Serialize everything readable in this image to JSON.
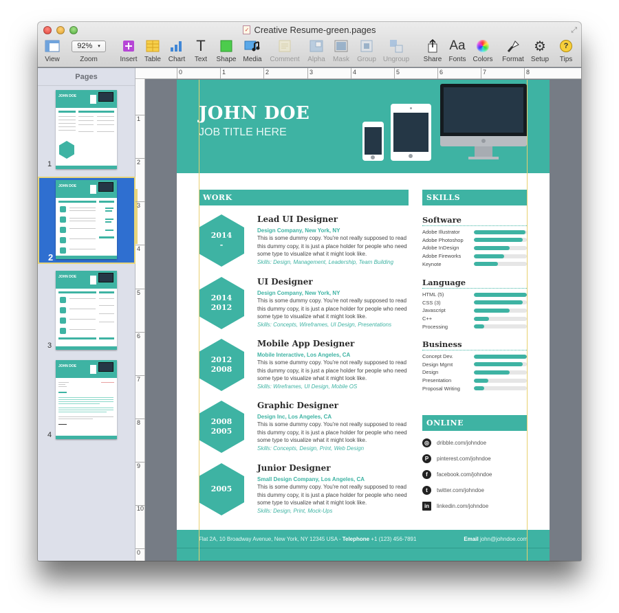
{
  "window": {
    "title": "Creative Resume-green.pages",
    "doc_icon": "pages-doc-icon"
  },
  "toolbar": {
    "zoom_value": "92%",
    "items": [
      {
        "label": "View",
        "icon": "view-icon",
        "enabled": true
      },
      {
        "label": "Zoom",
        "icon": "zoom-dropdown",
        "enabled": true
      },
      {
        "label": "Insert",
        "icon": "insert-icon",
        "enabled": true
      },
      {
        "label": "Table",
        "icon": "table-icon",
        "enabled": true
      },
      {
        "label": "Chart",
        "icon": "chart-icon",
        "enabled": true
      },
      {
        "label": "Text",
        "icon": "text-icon",
        "enabled": true
      },
      {
        "label": "Shape",
        "icon": "shape-icon",
        "enabled": true
      },
      {
        "label": "Media",
        "icon": "media-icon",
        "enabled": true
      },
      {
        "label": "Comment",
        "icon": "comment-icon",
        "enabled": false
      },
      {
        "label": "Alpha",
        "icon": "alpha-icon",
        "enabled": false
      },
      {
        "label": "Mask",
        "icon": "mask-icon",
        "enabled": false
      },
      {
        "label": "Group",
        "icon": "group-icon",
        "enabled": false
      },
      {
        "label": "Ungroup",
        "icon": "ungroup-icon",
        "enabled": false
      },
      {
        "label": "Share",
        "icon": "share-icon",
        "enabled": true
      },
      {
        "label": "Fonts",
        "icon": "fonts-icon",
        "enabled": true
      },
      {
        "label": "Colors",
        "icon": "colors-icon",
        "enabled": true
      },
      {
        "label": "Format",
        "icon": "format-icon",
        "enabled": true
      },
      {
        "label": "Setup",
        "icon": "setup-icon",
        "enabled": true
      },
      {
        "label": "Tips",
        "icon": "tips-icon",
        "enabled": true
      }
    ]
  },
  "sidebar": {
    "title": "Pages",
    "pages": [
      {
        "number": "1",
        "selected": false
      },
      {
        "number": "2",
        "selected": true
      },
      {
        "number": "3",
        "selected": false
      },
      {
        "number": "4",
        "selected": false
      }
    ]
  },
  "rulers": {
    "horizontal": [
      "0",
      "1",
      "2",
      "3",
      "4",
      "5",
      "6",
      "7",
      "8"
    ],
    "vertical": [
      "1",
      "2",
      "3",
      "4",
      "5",
      "6",
      "7",
      "8",
      "9",
      "10",
      "0"
    ]
  },
  "resume": {
    "name": "JOHN DOE",
    "job_title": "JOB TITLE HERE",
    "colors": {
      "accent": "#3eb3a3",
      "dark": "#253746"
    },
    "work_heading": "WORK",
    "jobs": [
      {
        "years": [
          "2014",
          "-"
        ],
        "title": "Lead UI Designer",
        "company": "Design Company, New York, NY",
        "description": "This is some dummy copy. You're not really supposed to read this dummy copy, it is just a place holder for people who need some type to visualize what it might look like.",
        "skills": "Skills: Design, Management, Leadership, Team Building"
      },
      {
        "years": [
          "2014",
          "2012"
        ],
        "title": "UI Designer",
        "company": "Design Company, New York, NY",
        "description": "This is some dummy copy. You're not really supposed to read this dummy copy, it is just a place holder for people who need some type to visualize what it might look like.",
        "skills": "Skills: Concepts, Wireframes, UI Design, Presentations"
      },
      {
        "years": [
          "2012",
          "2008"
        ],
        "title": "Mobile App Designer",
        "company": "Mobile Interactive, Los Angeles, CA",
        "description": "This is some dummy copy. You're not really supposed to read this dummy copy, it is just a place holder for people who need some type to visualize what it might look like.",
        "skills": "Skills: Wireframes, UI Design, Mobile OS"
      },
      {
        "years": [
          "2008",
          "2005"
        ],
        "title": "Graphic Designer",
        "company": "Design Inc, Los Angeles, CA",
        "description": "This is some dummy copy. You're not really supposed to read this dummy copy, it is just a place holder for people who need some type to visualize what it might look like.",
        "skills": "Skills: Concepts, Design, Print, Web Design"
      },
      {
        "years": [
          "2005",
          ""
        ],
        "title": "Junior Designer",
        "company": "Small Design Company, Los Angeles, CA",
        "description": "This is some dummy copy. You're not really supposed to read this dummy copy, it is just a place holder for people who need some type to visualize what it might look like.",
        "skills": "Skills: Design, Print, Mock-Ups"
      }
    ],
    "skills_heading": "SKILLS",
    "skill_groups": [
      {
        "title": "Software",
        "items": [
          {
            "name": "Adobe Illustrator",
            "level": 0.97
          },
          {
            "name": "Adobe Photoshop",
            "level": 0.92
          },
          {
            "name": "Adobe InDesign",
            "level": 0.68
          },
          {
            "name": "Adobe Fireworks",
            "level": 0.57
          },
          {
            "name": "Keynote",
            "level": 0.45
          }
        ]
      },
      {
        "title": "Language",
        "items": [
          {
            "name": "HTML (5)",
            "level": 1.0
          },
          {
            "name": "CSS (3)",
            "level": 0.92
          },
          {
            "name": "Javascript",
            "level": 0.68
          },
          {
            "name": "C++",
            "level": 0.28
          },
          {
            "name": "Processing",
            "level": 0.19
          }
        ]
      },
      {
        "title": "Business",
        "items": [
          {
            "name": "Concept Dev.",
            "level": 1.0
          },
          {
            "name": "Design Mgmt",
            "level": 0.92
          },
          {
            "name": "Design",
            "level": 0.68
          },
          {
            "name": "Presentation",
            "level": 0.27
          },
          {
            "name": "Proposal Writing",
            "level": 0.19
          }
        ]
      }
    ],
    "online_heading": "ONLINE",
    "online": [
      {
        "icon": "dribbble-icon",
        "glyph": "◎",
        "text": "dribble.com/johndoe"
      },
      {
        "icon": "pinterest-icon",
        "glyph": "P",
        "text": "pinterest.com/johndoe"
      },
      {
        "icon": "facebook-icon",
        "glyph": "f",
        "text": "facebook.com/johndoe"
      },
      {
        "icon": "twitter-icon",
        "glyph": "t",
        "text": "twitter.com/johndoe"
      },
      {
        "icon": "linkedin-icon",
        "glyph": "in",
        "text": "linkedin.com/johndoe"
      }
    ],
    "footer": {
      "address": "Flat 2A, 10 Broadway Avenue, New York, NY 12345 USA - ",
      "telephone_label": "Telephone",
      "telephone": " +1 (123) 456-7891",
      "email_label": "Email",
      "email": " john@johndoe.com"
    }
  }
}
